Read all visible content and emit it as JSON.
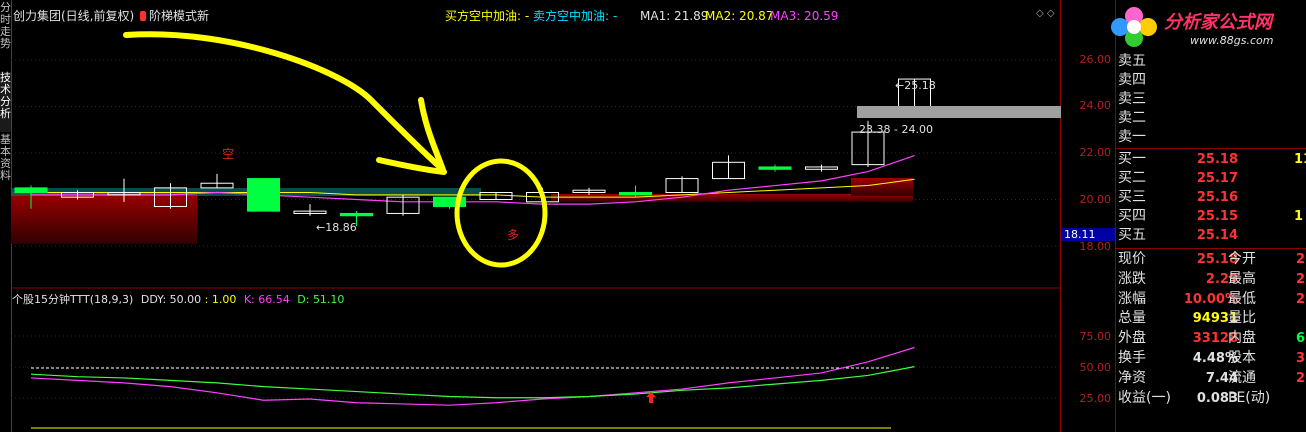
{
  "left_tabs": [
    "分时走势",
    "技术分析",
    "基本资料"
  ],
  "header": {
    "title": "创力集团(日线,前复权)",
    "indicator": "阶梯模式新",
    "buy_text": "买方空中加油: -",
    "sell_text": "卖方空中加油: -",
    "ma1": "MA1: 21.89",
    "ma2": "MA2: 20.87",
    "ma3": "MA3: 20.59"
  },
  "annotations": {
    "kong": "空",
    "duo": "多",
    "low_label": "18.86",
    "high_label": "25.18",
    "range_label": "23.38 - 24.00"
  },
  "price_axis": {
    "ticks": [
      "26.00",
      "24.00",
      "22.00",
      "20.00",
      "18.00"
    ],
    "current_price_box": "18.11"
  },
  "sub_chart": {
    "title": "个股15分钟TTT(18,9,3)",
    "ddy": "DDY: 50.00",
    "ddy2": ": 1.00",
    "k": "K: 66.54",
    "d": "D: 51.10",
    "ticks": [
      "75.00",
      "50.00",
      "25.00"
    ]
  },
  "logo": {
    "name": "分析家公式网",
    "url_text": "www.88gs.com"
  },
  "quote_panel": {
    "sell": [
      {
        "label": "卖五"
      },
      {
        "label": "卖四"
      },
      {
        "label": "卖三"
      },
      {
        "label": "卖二"
      },
      {
        "label": "卖一"
      }
    ],
    "buy": [
      {
        "label": "买一",
        "price": "25.18",
        "vol": "11"
      },
      {
        "label": "买二",
        "price": "25.17",
        "vol": ""
      },
      {
        "label": "买三",
        "price": "25.16",
        "vol": ""
      },
      {
        "label": "买四",
        "price": "25.15",
        "vol": "1"
      },
      {
        "label": "买五",
        "price": "25.14",
        "vol": ""
      }
    ],
    "stats": [
      {
        "l1": "现价",
        "v1": "25.18",
        "l2": "今开",
        "v2": "2"
      },
      {
        "l1": "涨跌",
        "v1": "2.29",
        "l2": "最高",
        "v2": "2"
      },
      {
        "l1": "涨幅",
        "v1": "10.00%",
        "l2": "最低",
        "v2": "2"
      },
      {
        "l1": "总量",
        "v1": "94931",
        "l2": "量比",
        "v2": ""
      },
      {
        "l1": "外盘",
        "v1": "33128",
        "l2": "内盘",
        "v2": "61"
      },
      {
        "l1": "换手",
        "v1": "4.48%",
        "l2": "股本",
        "v2": "3.1"
      },
      {
        "l1": "净资",
        "v1": "7.44",
        "l2": "流通",
        "v2": "2.1"
      },
      {
        "l1": "收益(一)",
        "v1": "0.083",
        "l2": "PE(动)",
        "v2": ""
      }
    ]
  },
  "colors": {
    "up": "#ff3030",
    "down": "#00ff40",
    "frame": "#8b0000",
    "ma1": "#ff40ff",
    "yellow": "#ffff00"
  },
  "chart_data": {
    "type": "candlestick",
    "y_range": [
      17.6,
      26.6
    ],
    "candles": [
      {
        "o": 20.3,
        "c": 20.5,
        "h": 20.6,
        "l": 19.6,
        "up": false
      },
      {
        "o": 20.1,
        "c": 20.3,
        "h": 20.4,
        "l": 20.0,
        "up": true
      },
      {
        "o": 20.2,
        "c": 20.3,
        "h": 20.9,
        "l": 19.9,
        "up": true
      },
      {
        "o": 19.7,
        "c": 20.5,
        "h": 20.7,
        "l": 19.6,
        "up": true
      },
      {
        "o": 20.5,
        "c": 20.7,
        "h": 21.1,
        "l": 20.5,
        "up": true
      },
      {
        "o": 20.9,
        "c": 19.5,
        "h": 20.9,
        "l": 19.5,
        "up": false
      },
      {
        "o": 19.4,
        "c": 19.5,
        "h": 19.8,
        "l": 19.3,
        "up": true
      },
      {
        "o": 19.4,
        "c": 19.3,
        "h": 19.5,
        "l": 18.86,
        "up": false
      },
      {
        "o": 19.4,
        "c": 20.1,
        "h": 20.2,
        "l": 19.3,
        "up": true
      },
      {
        "o": 20.1,
        "c": 19.7,
        "h": 20.1,
        "l": 19.6,
        "up": false
      },
      {
        "o": 20.0,
        "c": 20.3,
        "h": 20.3,
        "l": 20.0,
        "up": true
      },
      {
        "o": 19.9,
        "c": 20.3,
        "h": 20.5,
        "l": 19.8,
        "up": true
      },
      {
        "o": 20.4,
        "c": 20.3,
        "h": 20.5,
        "l": 20.2,
        "up": true
      },
      {
        "o": 20.3,
        "c": 20.2,
        "h": 20.6,
        "l": 20.1,
        "up": false
      },
      {
        "o": 20.3,
        "c": 20.9,
        "h": 21.0,
        "l": 20.3,
        "up": true
      },
      {
        "o": 20.9,
        "c": 21.6,
        "h": 21.9,
        "l": 20.9,
        "up": true
      },
      {
        "o": 21.4,
        "c": 21.3,
        "h": 21.5,
        "l": 21.2,
        "up": false
      },
      {
        "o": 21.3,
        "c": 21.4,
        "h": 21.5,
        "l": 21.2,
        "up": true
      },
      {
        "o": 21.5,
        "c": 22.9,
        "h": 23.38,
        "l": 21.4,
        "up": true
      },
      {
        "o": 24.0,
        "c": 25.18,
        "h": 25.18,
        "l": 24.0,
        "up": true
      }
    ],
    "ma1": [
      20.2,
      20.2,
      20.2,
      20.2,
      20.3,
      20.2,
      20.1,
      20.0,
      19.9,
      19.9,
      19.9,
      19.8,
      19.8,
      19.9,
      20.1,
      20.4,
      20.6,
      20.8,
      21.2,
      21.89
    ],
    "ma2": [
      20.3,
      20.3,
      20.3,
      20.3,
      20.3,
      20.3,
      20.3,
      20.2,
      20.2,
      20.2,
      20.2,
      20.1,
      20.1,
      20.1,
      20.2,
      20.3,
      20.4,
      20.5,
      20.6,
      20.87
    ],
    "k_line": [
      42,
      40,
      38,
      35,
      30,
      24,
      25,
      22,
      21,
      20,
      22,
      25,
      27,
      30,
      33,
      38,
      42,
      46,
      55,
      66.54
    ],
    "d_line": [
      45,
      43,
      42,
      40,
      38,
      35,
      33,
      31,
      29,
      27,
      26,
      26,
      27,
      29,
      32,
      34,
      37,
      40,
      44,
      51.1
    ],
    "osc_range": [
      0,
      100
    ]
  }
}
